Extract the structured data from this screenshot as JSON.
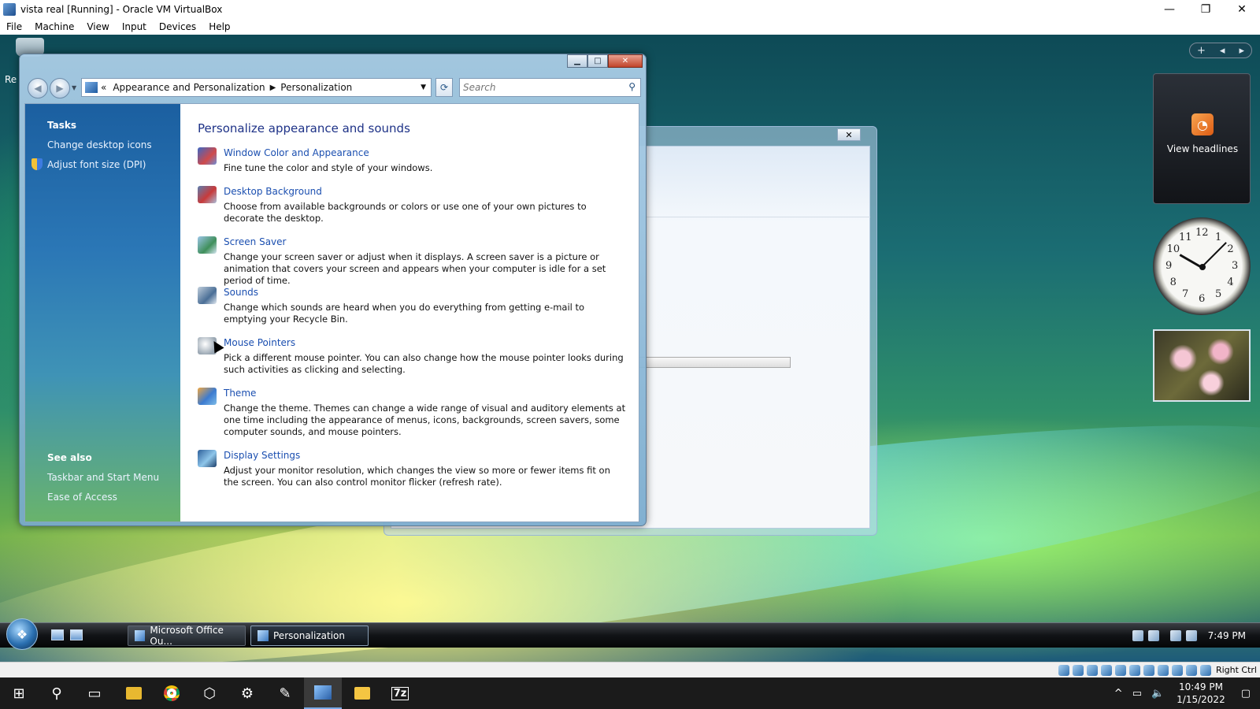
{
  "host": {
    "title": "vista real [Running] - Oracle VM VirtualBox",
    "menu": [
      "File",
      "Machine",
      "View",
      "Input",
      "Devices",
      "Help"
    ],
    "status_right": "Right Ctrl"
  },
  "desktop": {
    "recycle_label": "Re"
  },
  "window": {
    "breadcrumb_prefix": "«",
    "breadcrumb": [
      "Appearance and Personalization",
      "Personalization"
    ],
    "search_placeholder": "Search",
    "tasks_heading": "Tasks",
    "tasks": [
      "Change desktop icons",
      "Adjust font size (DPI)"
    ],
    "see_also_heading": "See also",
    "see_also": [
      "Taskbar and Start Menu",
      "Ease of Access"
    ],
    "heading": "Personalize appearance and sounds",
    "items": [
      {
        "title": "Window Color and Appearance",
        "desc": "Fine tune the color and style of your windows.",
        "icon": "window-color-icon"
      },
      {
        "title": "Desktop Background",
        "desc": "Choose from available backgrounds or colors or use one of your own pictures to decorate the desktop.",
        "icon": "desktop-background-icon"
      },
      {
        "title": "Screen Saver",
        "desc": "Change your screen saver or adjust when it displays. A screen saver is a picture or animation that covers your screen and appears when your computer is idle for a set period of time.",
        "icon": "screen-saver-icon"
      },
      {
        "title": "Sounds",
        "desc": "Change which sounds are heard when you do everything from getting e-mail to emptying your Recycle Bin.",
        "icon": "sounds-icon"
      },
      {
        "title": "Mouse Pointers",
        "desc": "Pick a different mouse pointer. You can also change how the mouse pointer looks during such activities as clicking and selecting.",
        "icon": "mouse-pointers-icon"
      },
      {
        "title": "Theme",
        "desc": "Change the theme. Themes can change a wide range of visual and auditory elements at one time including the appearance of menus, icons, backgrounds, screen savers, some computer sounds, and mouse pointers.",
        "icon": "theme-icon"
      },
      {
        "title": "Display Settings",
        "desc": "Adjust your monitor resolution, which changes the view so more or fewer items fit on the screen. You can also control monitor flicker (refresh rate).",
        "icon": "display-settings-icon"
      }
    ]
  },
  "gadgets": {
    "rss_label": "View headlines",
    "clock_numbers": [
      "12",
      "1",
      "2",
      "3",
      "4",
      "5",
      "6",
      "7",
      "8",
      "9",
      "10",
      "11"
    ]
  },
  "vista_taskbar": {
    "tasks": [
      "Microsoft Office Ou...",
      "Personalization"
    ],
    "time": "7:49 PM"
  },
  "win10_taskbar": {
    "time": "10:49 PM",
    "date": "1/15/2022"
  }
}
